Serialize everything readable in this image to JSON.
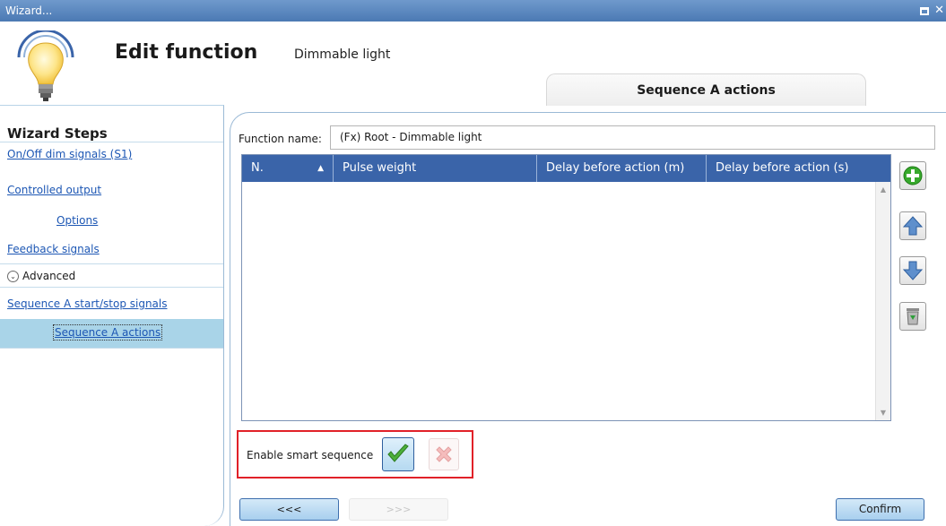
{
  "window": {
    "title": "Wizard..."
  },
  "header": {
    "title": "Edit function",
    "subtitle": "Dimmable light",
    "tab": "Sequence A actions"
  },
  "steps": {
    "title": "Wizard Steps",
    "items": [
      {
        "label": "On/Off dim signals (S1)"
      },
      {
        "label": "Controlled output"
      },
      {
        "label": "Options"
      },
      {
        "label": "Feedback signals"
      },
      {
        "label": "Advanced"
      },
      {
        "label": "Sequence A start/stop signals"
      },
      {
        "label": "Sequence A actions",
        "active": true
      }
    ]
  },
  "function_name": {
    "label": "Function name:",
    "value": "(Fx) Root - Dimmable light"
  },
  "table": {
    "columns": [
      "N.",
      "Pulse weight",
      "Delay before action (m)",
      "Delay before action (s)"
    ],
    "rows": []
  },
  "side_buttons": [
    "add-icon",
    "move-up-icon",
    "move-down-icon",
    "delete-icon"
  ],
  "smart_sequence": {
    "label": "Enable smart sequence",
    "enabled": true
  },
  "nav": {
    "back": "<<<",
    "next": ">>>",
    "confirm": "Confirm"
  },
  "colors": {
    "header_blue": "#3a64a9",
    "selected_step": "#a9d4e8",
    "highlight_border": "#e12128",
    "link": "#1d57b4"
  }
}
